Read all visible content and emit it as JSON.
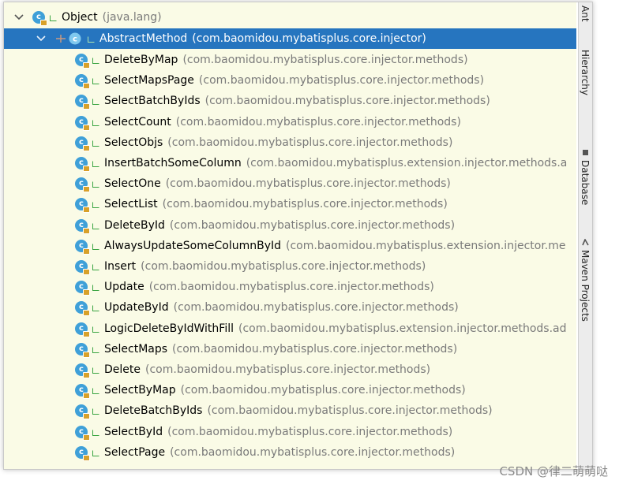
{
  "tree": {
    "root": {
      "name": "Object",
      "package": "(java.lang)"
    },
    "selected": {
      "name": "AbstractMethod",
      "package": "(com.baomidou.mybatisplus.core.injector)"
    },
    "children": [
      {
        "name": "DeleteByMap",
        "package": "(com.baomidou.mybatisplus.core.injector.methods)"
      },
      {
        "name": "SelectMapsPage",
        "package": "(com.baomidou.mybatisplus.core.injector.methods)"
      },
      {
        "name": "SelectBatchByIds",
        "package": "(com.baomidou.mybatisplus.core.injector.methods)"
      },
      {
        "name": "SelectCount",
        "package": "(com.baomidou.mybatisplus.core.injector.methods)"
      },
      {
        "name": "SelectObjs",
        "package": "(com.baomidou.mybatisplus.core.injector.methods)"
      },
      {
        "name": "InsertBatchSomeColumn",
        "package": "(com.baomidou.mybatisplus.extension.injector.methods.a"
      },
      {
        "name": "SelectOne",
        "package": "(com.baomidou.mybatisplus.core.injector.methods)"
      },
      {
        "name": "SelectList",
        "package": "(com.baomidou.mybatisplus.core.injector.methods)"
      },
      {
        "name": "DeleteById",
        "package": "(com.baomidou.mybatisplus.core.injector.methods)"
      },
      {
        "name": "AlwaysUpdateSomeColumnById",
        "package": "(com.baomidou.mybatisplus.extension.injector.me"
      },
      {
        "name": "Insert",
        "package": "(com.baomidou.mybatisplus.core.injector.methods)"
      },
      {
        "name": "Update",
        "package": "(com.baomidou.mybatisplus.core.injector.methods)"
      },
      {
        "name": "UpdateById",
        "package": "(com.baomidou.mybatisplus.core.injector.methods)"
      },
      {
        "name": "LogicDeleteByIdWithFill",
        "package": "(com.baomidou.mybatisplus.extension.injector.methods.ad"
      },
      {
        "name": "SelectMaps",
        "package": "(com.baomidou.mybatisplus.core.injector.methods)"
      },
      {
        "name": "Delete",
        "package": "(com.baomidou.mybatisplus.core.injector.methods)"
      },
      {
        "name": "SelectByMap",
        "package": "(com.baomidou.mybatisplus.core.injector.methods)"
      },
      {
        "name": "DeleteBatchByIds",
        "package": "(com.baomidou.mybatisplus.core.injector.methods)"
      },
      {
        "name": "SelectById",
        "package": "(com.baomidou.mybatisplus.core.injector.methods)"
      },
      {
        "name": "SelectPage",
        "package": "(com.baomidou.mybatisplus.core.injector.methods)"
      }
    ]
  },
  "icons": {
    "class": "class-icon",
    "abstract_class": "abstract-class-icon",
    "visibility": "public-visibility-icon"
  },
  "colors": {
    "selection": "#2675bf",
    "tree_bg": "#fafbe6",
    "class_icon": "#3fa0d8",
    "package_text": "#7a7a7a"
  },
  "sidebar": {
    "tabs": [
      "Ant",
      "Hierarchy",
      "Database",
      "Maven Projects"
    ]
  },
  "watermark": "CSDN @律二萌萌哒"
}
